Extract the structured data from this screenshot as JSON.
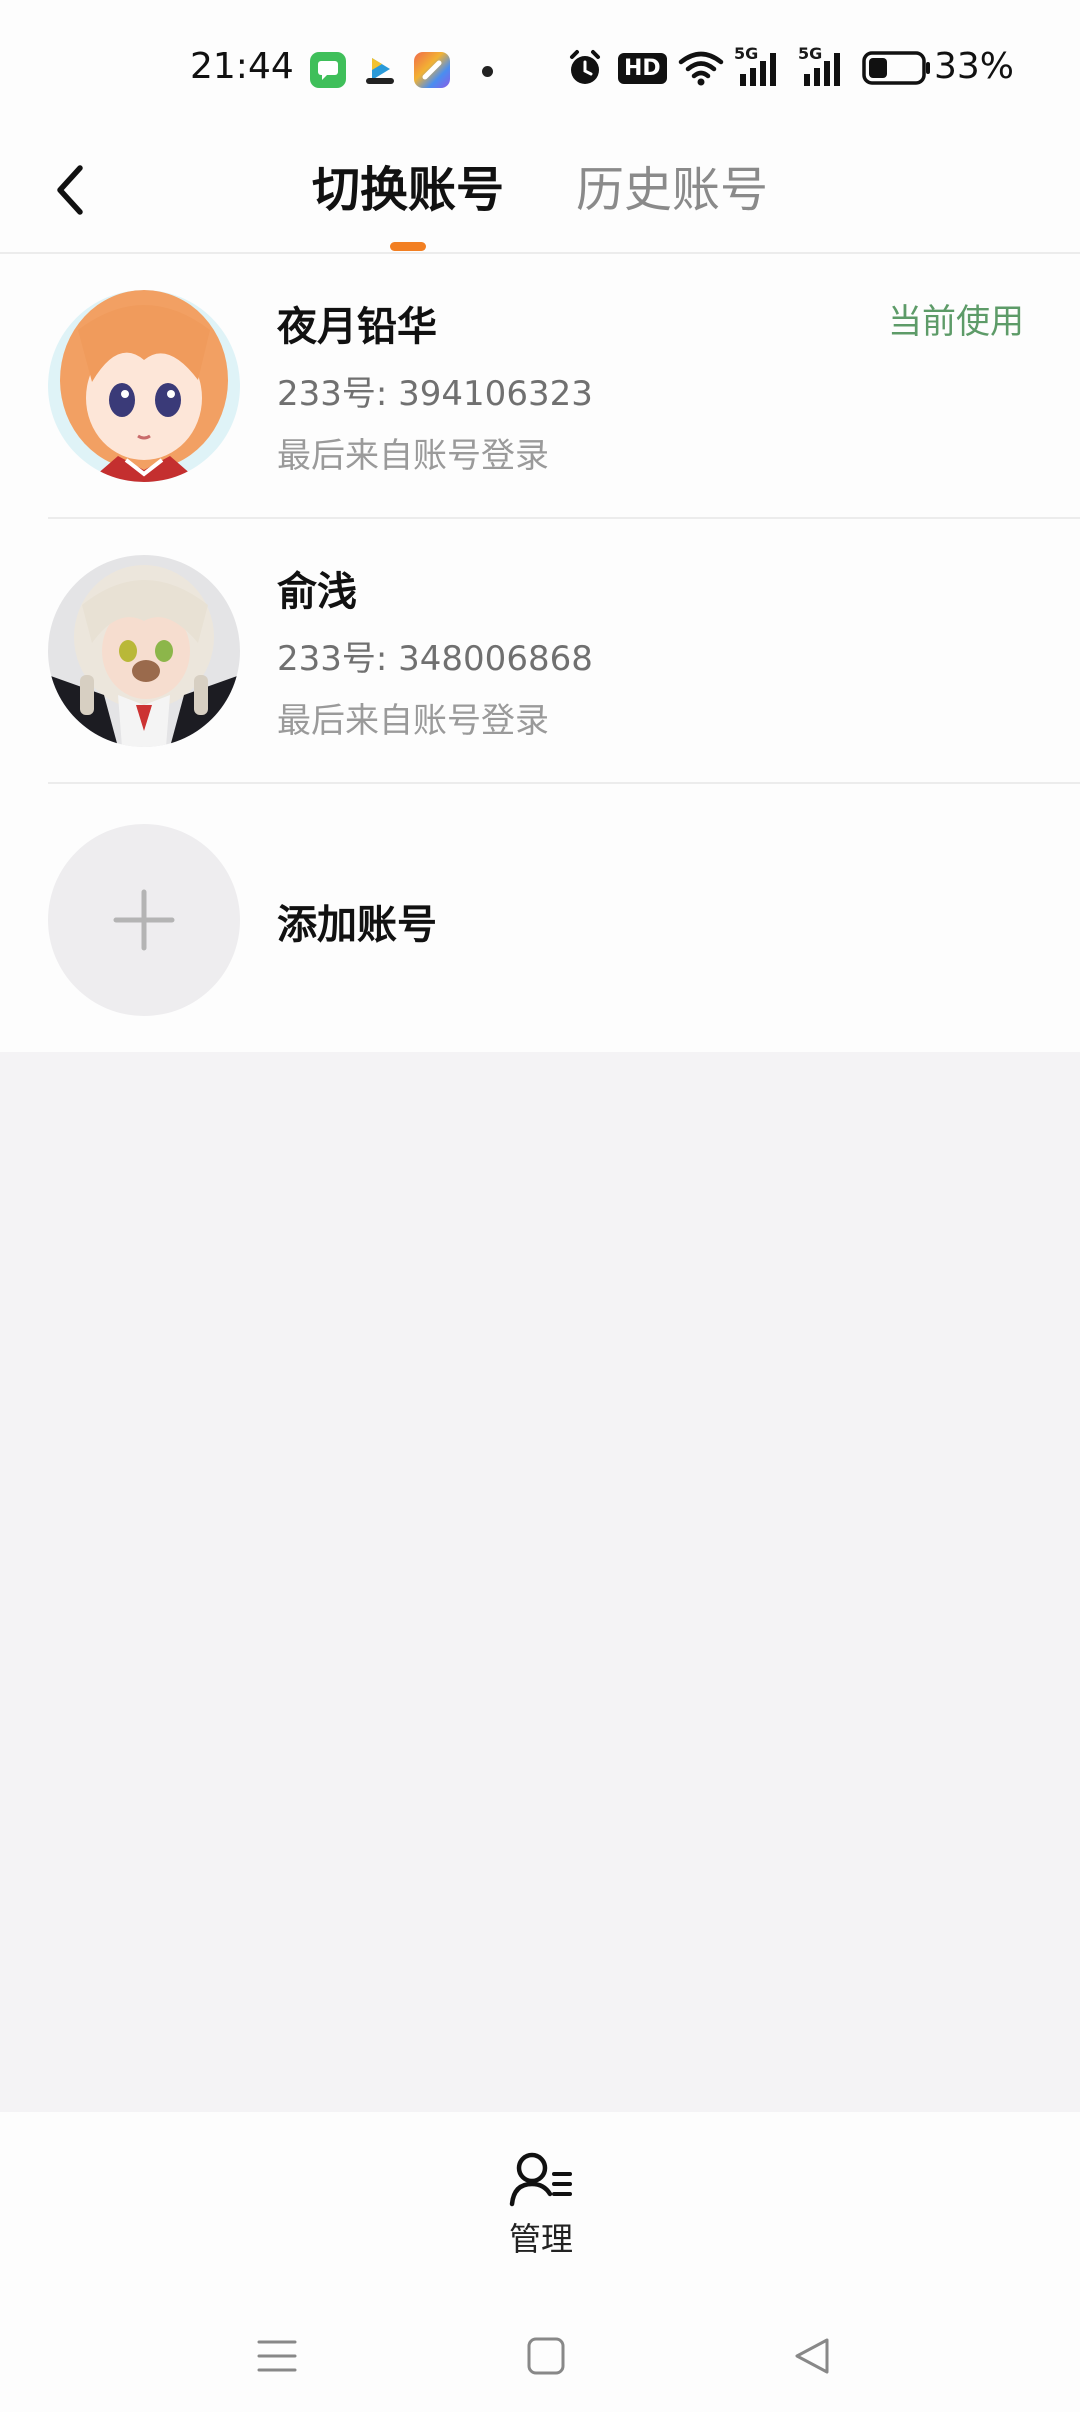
{
  "status_bar": {
    "time": "21:44",
    "battery_percent": "33%",
    "network_1": "5G",
    "network_2": "5G",
    "hd_badge": "HD",
    "icons": [
      "messages-app-icon",
      "video-app-icon",
      "office-app-icon",
      "notification-dot",
      "alarm-icon",
      "hd-voice-icon",
      "wifi-icon",
      "signal-5g-icon",
      "signal-5g-icon",
      "battery-icon"
    ]
  },
  "header": {
    "tabs": [
      {
        "label": "切换账号",
        "active": true
      },
      {
        "label": "历史账号",
        "active": false
      }
    ],
    "accent_color": "#f27f22"
  },
  "accounts": [
    {
      "name": "夜月铅华",
      "uid": "233号: 394106323",
      "last_login": "最后来自账号登录",
      "badge": "当前使用",
      "avatar": "avatar-orange-hair-anime-girl"
    },
    {
      "name": "俞浅",
      "uid": "233号: 348006868",
      "last_login": "最后来自账号登录",
      "badge": "",
      "avatar": "avatar-white-hair-anime-girl"
    }
  ],
  "add_account": {
    "label": "添加账号",
    "icon": "plus-icon"
  },
  "bottom": {
    "manage_label": "管理",
    "manage_icon": "user-manage-icon"
  },
  "nav": {
    "icons": [
      "menu-icon",
      "home-icon",
      "back-triangle-icon"
    ]
  },
  "colors": {
    "current_badge": "#5d9b68",
    "page_bg": "#f4f3f5"
  }
}
